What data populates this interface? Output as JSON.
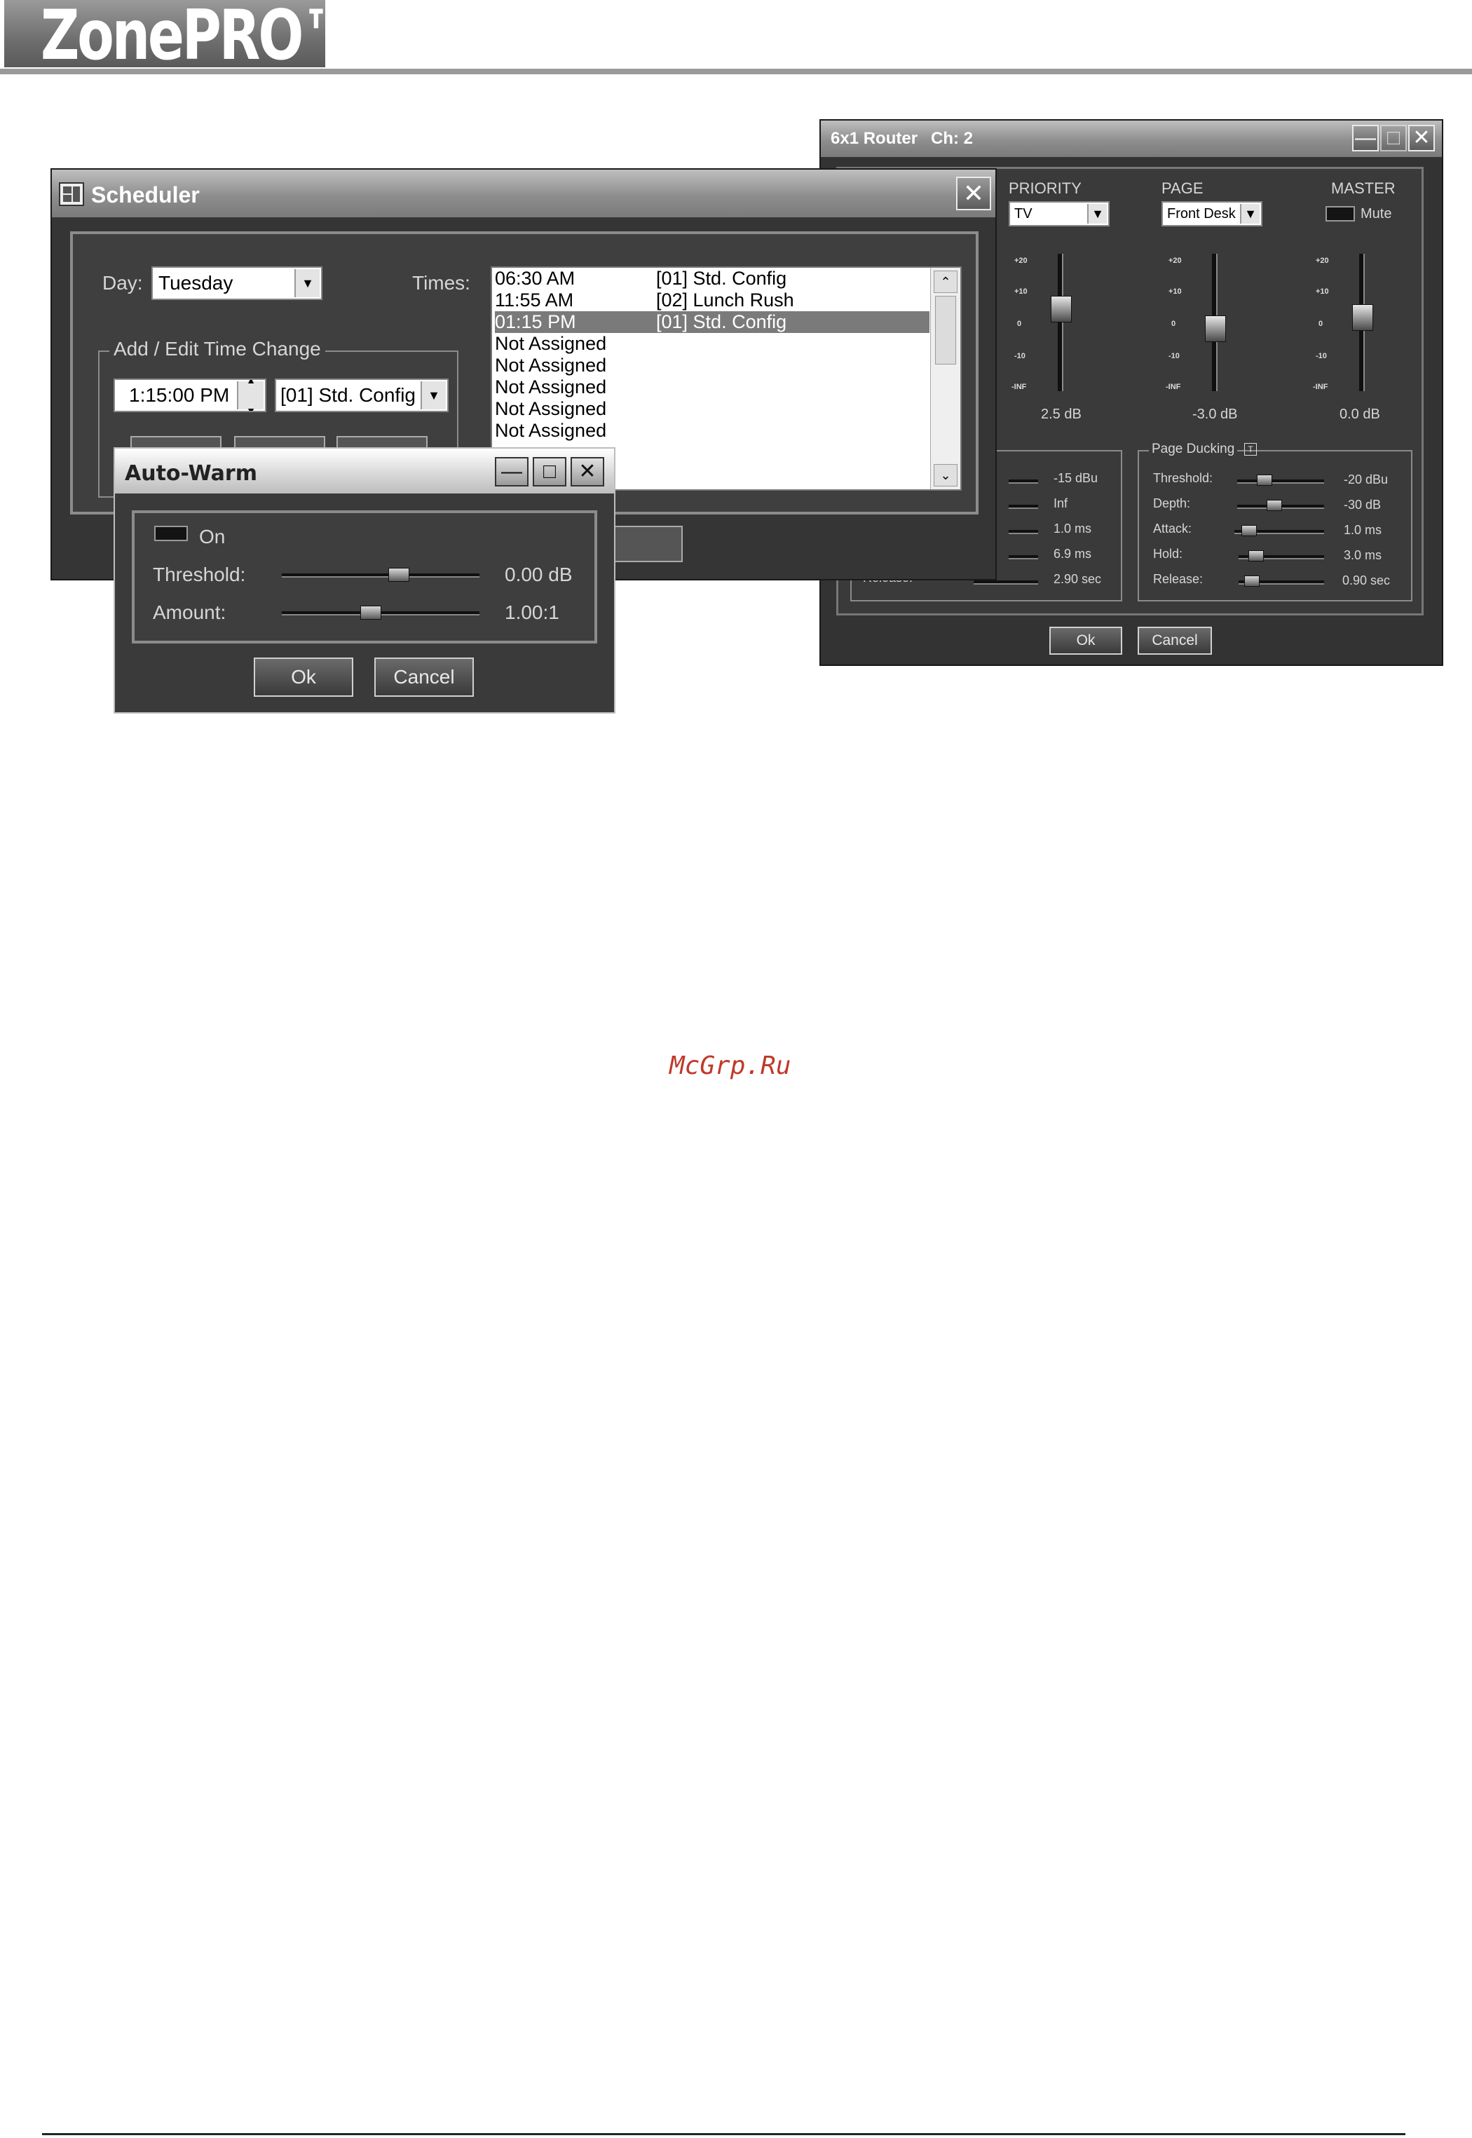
{
  "brand": {
    "logo_text": "ZonePRO™",
    "accent": "#9a9a9a"
  },
  "watermark": "McGrp.Ru",
  "scheduler": {
    "title": "Scheduler",
    "day_label": "Day:",
    "day_value": "Tuesday",
    "times_label": "Times:",
    "times": [
      {
        "time": "06:30 AM",
        "config": "[01] Std. Config",
        "selected": false
      },
      {
        "time": "11:55 AM",
        "config": "[02] Lunch Rush",
        "selected": false
      },
      {
        "time": "01:15 PM",
        "config": "[01] Std. Config",
        "selected": true
      },
      {
        "time": "Not Assigned",
        "config": ""
      },
      {
        "time": "Not Assigned",
        "config": ""
      },
      {
        "time": "Not Assigned",
        "config": ""
      },
      {
        "time": "Not Assigned",
        "config": ""
      },
      {
        "time": "Not Assigned",
        "config": ""
      }
    ],
    "group_label": "Add / Edit Time Change",
    "time_value": "1:15:00 PM",
    "config_value": "[01] Std. Config"
  },
  "autowarm": {
    "title": "Auto-Warm",
    "on_label": "On",
    "threshold_label": "Threshold:",
    "threshold_value": "0.00 dB",
    "amount_label": "Amount:",
    "amount_value": "1.00:1",
    "ok_label": "Ok",
    "cancel_label": "Cancel"
  },
  "router": {
    "title": "6x1 Router",
    "channel": "Ch: 2",
    "priority_label": "PRIORITY",
    "priority_value": "TV",
    "page_label": "PAGE",
    "page_value": "Front Desk",
    "master_label": "MASTER",
    "mute_label": "Mute",
    "scale": [
      "+20",
      "+10",
      "0",
      "-10",
      "-INF"
    ],
    "fader_values": [
      "2.5 dB",
      "-3.0 dB",
      "0.0 dB"
    ],
    "left_group": {
      "release_label": "Release:",
      "values": [
        "-15 dBu",
        "Inf",
        "1.0 ms",
        "6.9 ms",
        "2.90 sec"
      ]
    },
    "page_ducking": {
      "title": "Page Ducking",
      "rows": [
        {
          "label": "Threshold:",
          "value": "-20 dBu"
        },
        {
          "label": "Depth:",
          "value": "-30 dB"
        },
        {
          "label": "Attack:",
          "value": "1.0 ms"
        },
        {
          "label": "Hold:",
          "value": "3.0 ms"
        },
        {
          "label": "Release:",
          "value": "0.90 sec"
        }
      ]
    },
    "ok_label": "Ok",
    "cancel_label": "Cancel"
  }
}
